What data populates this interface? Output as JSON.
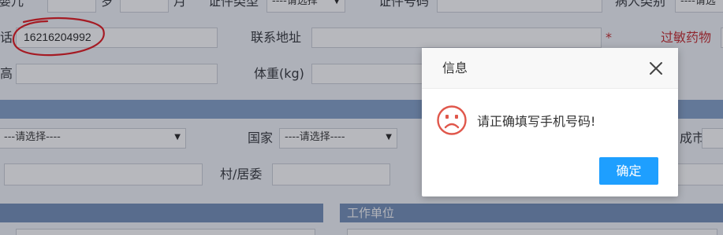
{
  "form": {
    "row1": {
      "age_unit_partial": "婴儿",
      "age_sui": "岁",
      "age_month": "月",
      "id_type_label": "证件类型",
      "id_type_value": "----请选择",
      "id_number_label": "证件号码",
      "patient_type_label": "病人类别",
      "patient_type_value": "----请选"
    },
    "row2": {
      "phone_label_partial": "话",
      "phone_value": "16216204992",
      "address_label": "联系地址",
      "required_mark": "*",
      "allergy_label": "过敏药物"
    },
    "row3": {
      "height_label_partial": "高",
      "weight_label": "体重(kg)"
    },
    "row4": {
      "select1_value": "---请选择----",
      "country_label": "国家",
      "country_value": "----请选择----",
      "city_label_partial": "成市"
    },
    "row5": {
      "village_label": "村/居委"
    },
    "panels": {
      "work_unit_label": "工作单位"
    }
  },
  "dialog": {
    "title": "信息",
    "message": "请正确填写手机号码!",
    "ok_label": "确定",
    "icon": "sad-face-icon",
    "close_icon": "close-icon"
  },
  "colors": {
    "accent": "#1e9fff",
    "error_icon": "#e0574b",
    "annotation": "#e0141b",
    "required": "#c2252b",
    "section_bar": "#7f9dc6"
  }
}
